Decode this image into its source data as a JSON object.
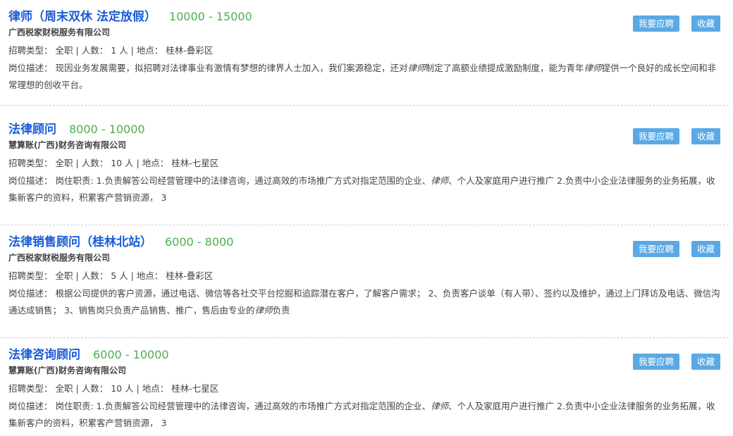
{
  "labels": {
    "type_prefix": "招聘类型：",
    "count_prefix": "人数：",
    "location_prefix": "地点：",
    "desc_prefix": "岗位描述：",
    "apply": "我要应聘",
    "save": "收藏"
  },
  "jobs": [
    {
      "title": "律师（周末双休 法定放假）",
      "salary": "10000 - 15000",
      "company": "广西税家财税服务有限公司",
      "type": "全职",
      "count": "1 人",
      "location": "桂林-叠彩区",
      "desc_a": "现因业务发展需要，拟招聘对法律事业有激情有梦想的律界人士加入，我们案源稳定，还对",
      "desc_kw1": "律师",
      "desc_b": "制定了高额业绩提成激励制度，能为青年",
      "desc_kw2": "律师",
      "desc_c": "提供一个良好的成长空间和非常理想的创收平台。"
    },
    {
      "title": "法律顾问",
      "salary": "8000 - 10000",
      "company": "慧算账(广西)财务咨询有限公司",
      "type": "全职",
      "count": "10 人",
      "location": "桂林-七星区",
      "desc_a": "岗住职责: 1.负责解答公司经营管理中的法律咨询，通过高效的市场推广方式对指定范围的企业、",
      "desc_kw1": "律师",
      "desc_b": "、个人及家庭用户进行推广 2.负责中小企业法律服务的业务拓展，收集新客户的资料，积累客产营销资源， 3",
      "desc_kw2": "",
      "desc_c": ""
    },
    {
      "title": "法律销售顾问（桂林北站）",
      "salary": "6000 - 8000",
      "company": "广西税家财税服务有限公司",
      "type": "全职",
      "count": "5 人",
      "location": "桂林-叠彩区",
      "desc_a": "根据公司提供的客户资源，通过电话、微信等各社交平台挖掘和追踪潜在客户，了解客户需求； 2、负责客户谈单（有人带）、签约以及维护，通过上门拜访及电话、微信沟通达成销售； 3、销售岗只负责产品销售、推广，售后由专业的",
      "desc_kw1": "律师",
      "desc_b": "负责",
      "desc_kw2": "",
      "desc_c": ""
    },
    {
      "title": "法律咨询顾问",
      "salary": "6000 - 10000",
      "company": "慧算账(广西)财务咨询有限公司",
      "type": "全职",
      "count": "10 人",
      "location": "桂林-七星区",
      "desc_a": "岗住职责: 1.负责解答公司经营管理中的法律咨询，通过高效的市场推广方式对指定范围的企业、",
      "desc_kw1": "律师",
      "desc_b": "、个人及家庭用户进行推广 2.负责中小企业法律服务的业务拓展，收集新客户的资料，积累客产营销资源， 3",
      "desc_kw2": "",
      "desc_c": ""
    }
  ]
}
